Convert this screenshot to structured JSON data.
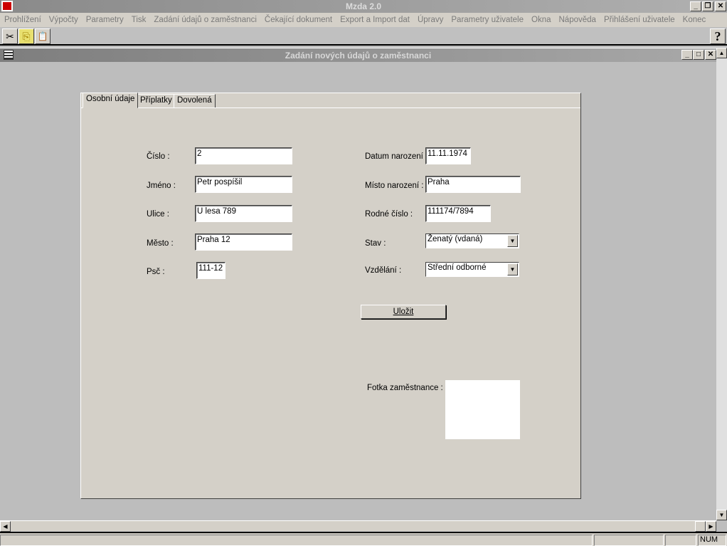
{
  "app": {
    "title": "Mzda 2.0"
  },
  "menu": [
    "Prohlížení",
    "Výpočty",
    "Parametry",
    "Tisk",
    "Zadání údajů o zaměstnanci",
    "Čekající dokument",
    "Export a Import dat",
    "Úpravy",
    "Parametry uživatele",
    "Okna",
    "Nápověda",
    "Přihlášení uživatele",
    "Konec"
  ],
  "toolbar": {
    "cut": "✂",
    "copy": "⎘",
    "paste": "📋",
    "help": "?"
  },
  "child": {
    "title": "Zadání nových údajů o zaměstnanci"
  },
  "tabs": [
    "Osobní údaje",
    "Příplatky",
    "Dovolená"
  ],
  "form": {
    "cislo": {
      "label": "Číslo :",
      "value": "2"
    },
    "jmeno": {
      "label": "Jméno :",
      "value": "Petr pospíšil"
    },
    "ulice": {
      "label": "Ulice :",
      "value": "U lesa 789"
    },
    "mesto": {
      "label": "Město :",
      "value": "Praha 12"
    },
    "psc": {
      "label": "Psč :",
      "value": "111-12"
    },
    "datum": {
      "label": "Datum narození :",
      "value": "11.11.1974"
    },
    "misto": {
      "label": "Místo narození :",
      "value": "Praha"
    },
    "rodne": {
      "label": "Rodné číslo :",
      "value": "111174/7894"
    },
    "stav": {
      "label": "Stav :",
      "value": "Ženatý (vdaná)"
    },
    "vzdelani": {
      "label": "Vzdělání :",
      "value": "Střední odborné"
    },
    "save": "Uložit",
    "photo": {
      "label": "Fotka zaměstnance :"
    }
  },
  "status": {
    "num": "NUM"
  }
}
